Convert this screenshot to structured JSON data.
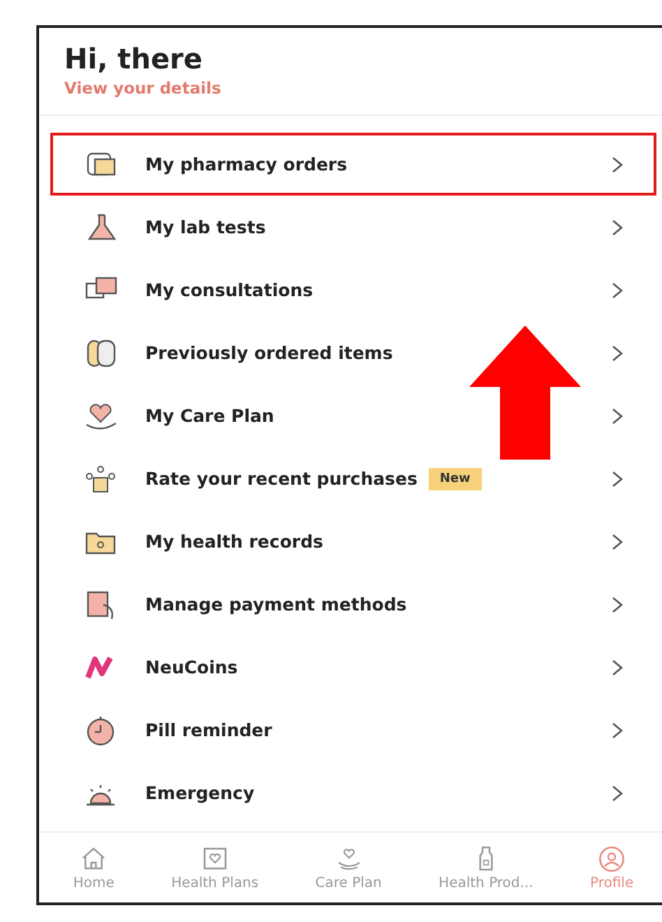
{
  "header": {
    "greeting": "Hi, there",
    "link": "View your details"
  },
  "menu": [
    {
      "label": "My pharmacy orders",
      "highlighted": true
    },
    {
      "label": "My lab tests",
      "highlighted": false
    },
    {
      "label": "My consultations",
      "highlighted": false
    },
    {
      "label": "Previously ordered items",
      "highlighted": false
    },
    {
      "label": "My Care Plan",
      "highlighted": false
    },
    {
      "label": "Rate your recent purchases",
      "badge": "New",
      "highlighted": false
    },
    {
      "label": "My health records",
      "highlighted": false
    },
    {
      "label": "Manage payment methods",
      "highlighted": false
    },
    {
      "label": "NeuCoins",
      "highlighted": false
    },
    {
      "label": "Pill reminder",
      "highlighted": false
    },
    {
      "label": "Emergency",
      "highlighted": false
    }
  ],
  "bottom_nav": [
    {
      "label": "Home",
      "selected": false
    },
    {
      "label": "Health Plans",
      "selected": false
    },
    {
      "label": "Care Plan",
      "selected": false
    },
    {
      "label": "Health Prod...",
      "selected": false
    },
    {
      "label": "Profile",
      "selected": true
    }
  ]
}
